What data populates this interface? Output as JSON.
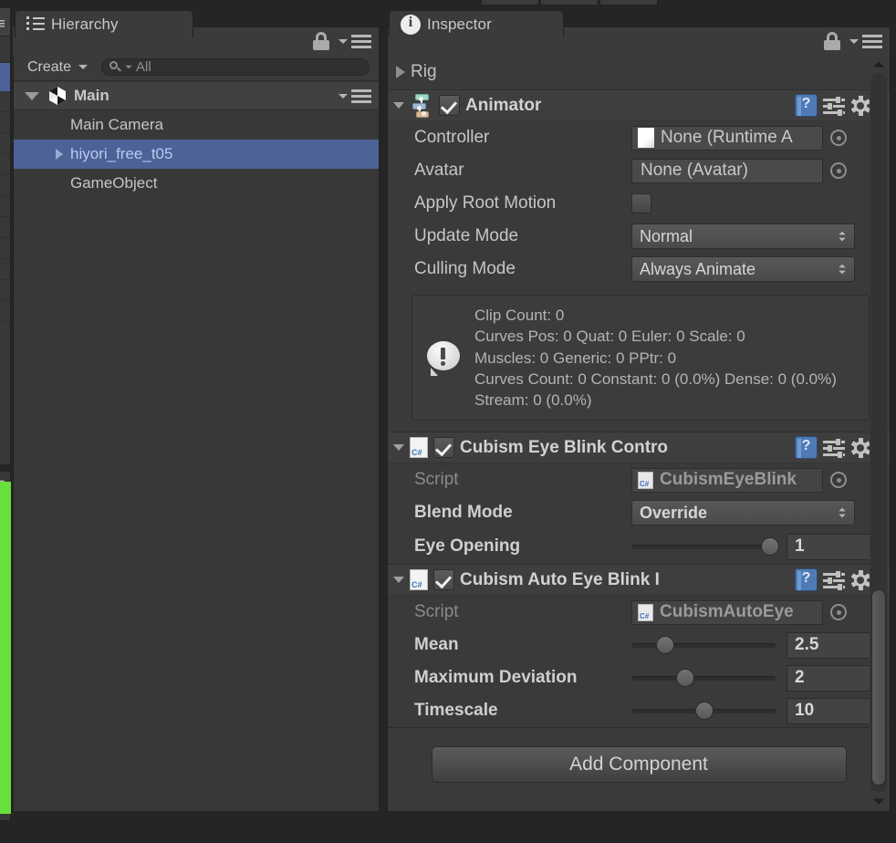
{
  "app": {
    "title": "Unity Editor"
  },
  "hierarchy": {
    "tab_label": "Hierarchy",
    "tab_icon": "hierarchy-icon",
    "lock_icon": "lock-icon",
    "menu_icon": "hamburger-menu-icon",
    "create_label": "Create",
    "search_placeholder": "All",
    "search_value": "All",
    "search_icon": "search-icon",
    "root": {
      "label": "Main",
      "icon": "unity-scene-icon",
      "expanded": true
    },
    "items": [
      {
        "label": "Main Camera",
        "selected": false,
        "has_children": false
      },
      {
        "label": "hiyori_free_t05",
        "selected": true,
        "has_children": true
      },
      {
        "label": "GameObject",
        "selected": false,
        "has_children": false
      }
    ]
  },
  "inspector": {
    "tab_label": "Inspector",
    "tab_icon": "info-icon",
    "lock_icon": "lock-icon",
    "menu_icon": "hamburger-menu-icon",
    "rig": {
      "label": "Rig",
      "expanded": false
    },
    "components": [
      {
        "name": "Animator",
        "icon": "animator-icon",
        "enabled": true,
        "expanded": true,
        "help_icon": "help-icon",
        "preset_icon": "preset-icon",
        "gear_icon": "gear-icon",
        "properties": [
          {
            "label": "Controller",
            "type": "object",
            "value": "None (Runtime A",
            "icon": "asset-doc-icon"
          },
          {
            "label": "Avatar",
            "type": "object",
            "value": "None (Avatar)"
          },
          {
            "label": "Apply Root Motion",
            "type": "checkbox",
            "checked": false
          },
          {
            "label": "Update Mode",
            "type": "popup",
            "value": "Normal"
          },
          {
            "label": "Culling Mode",
            "type": "popup",
            "value": "Always Animate"
          }
        ],
        "info_box": {
          "icon": "info-bubble-icon",
          "lines": [
            "Clip Count: 0",
            "Curves Pos: 0 Quat: 0 Euler: 0 Scale: 0",
            "Muscles: 0 Generic: 0 PPtr: 0",
            "Curves Count: 0 Constant: 0 (0.0%) Dense: 0",
            "(0.0%) Stream: 0 (0.0%)"
          ]
        }
      },
      {
        "name": "Cubism Eye Blink Contro",
        "icon": "csharp-script-icon",
        "enabled": true,
        "expanded": true,
        "help_icon": "help-icon",
        "preset_icon": "preset-icon",
        "gear_icon": "gear-icon",
        "properties": [
          {
            "label": "Script",
            "type": "object",
            "value": "CubismEyeBlink",
            "dim": true,
            "icon": "csharp-small-icon"
          },
          {
            "label": "Blend Mode",
            "type": "popup",
            "value": "Override"
          },
          {
            "label": "Eye Opening",
            "type": "slider",
            "value": "1",
            "fraction": 0.92
          }
        ]
      },
      {
        "name": "Cubism Auto Eye Blink I",
        "icon": "csharp-script-icon",
        "enabled": true,
        "expanded": true,
        "help_icon": "help-icon",
        "preset_icon": "preset-icon",
        "gear_icon": "gear-icon",
        "properties": [
          {
            "label": "Script",
            "type": "object",
            "value": "CubismAutoEye",
            "dim": true,
            "icon": "csharp-small-icon"
          },
          {
            "label": "Mean",
            "type": "slider",
            "value": "2.5",
            "fraction": 0.19
          },
          {
            "label": "Maximum Deviation",
            "type": "slider",
            "value": "2",
            "fraction": 0.33
          },
          {
            "label": "Timescale",
            "type": "slider",
            "value": "10",
            "fraction": 0.46
          }
        ]
      }
    ],
    "add_component_label": "Add Component",
    "scrollbar": {
      "up_arrow": "scroll-up-arrow",
      "down_arrow": "scroll-down-arrow",
      "thumb_top_pct": 72,
      "thumb_height_pct": 26
    }
  },
  "colors": {
    "panel_bg": "#383838",
    "header_bg": "#3e3e3e",
    "selection_blue": "#4d6296",
    "selection_text": "#b9c9ef",
    "text": "#c8c8c8",
    "text_dim": "#8b8b8b",
    "green_strip": "#66e03a",
    "window_bg": "#252525"
  }
}
